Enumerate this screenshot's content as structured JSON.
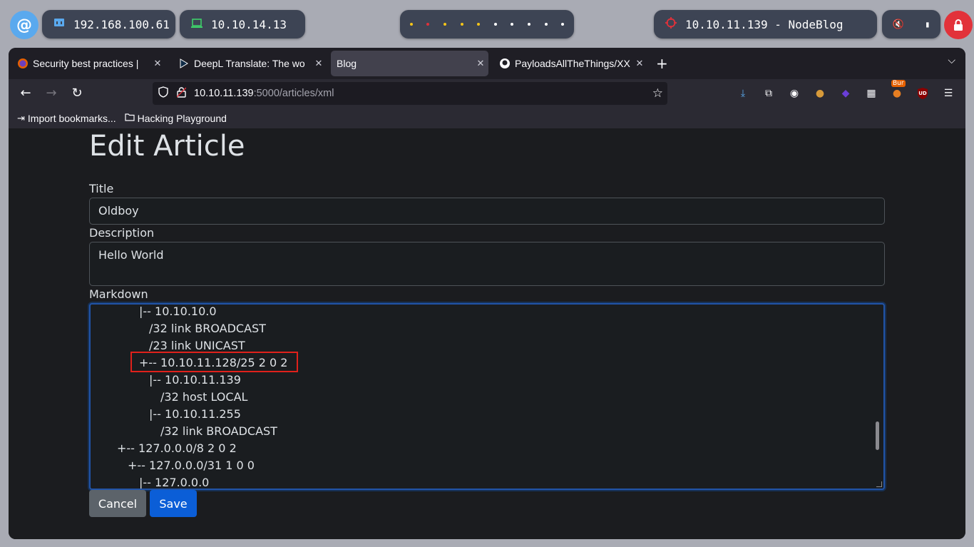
{
  "system_bar": {
    "ip_local": "192.168.100.61",
    "ip_vpn": "10.10.14.13",
    "target": "10.10.11.139 - NodeBlog",
    "workspace_colors": [
      "#f5c518",
      "#e0313a",
      "#f5c518",
      "#f5c518",
      "#f5c518",
      "#ffffff",
      "#ffffff",
      "#ffffff",
      "#ffffff",
      "#ffffff"
    ]
  },
  "browser": {
    "tabs": [
      {
        "label": "Security best practices |",
        "icon": "firefox-icon"
      },
      {
        "label": "DeepL Translate: The wo",
        "icon": "deepl-icon"
      },
      {
        "label": "Blog",
        "icon": "none",
        "active": true
      },
      {
        "label": "PayloadsAllTheThings/XX",
        "icon": "github-icon"
      }
    ],
    "url": {
      "host": "10.10.11.139",
      "path": ":5000/articles/xml"
    },
    "bookmarks": [
      {
        "label": "Import bookmarks...",
        "icon": "import-icon"
      },
      {
        "label": "Hacking Playground",
        "icon": "folder-icon"
      }
    ],
    "extensions": [
      "download-icon",
      "extensions-icon",
      "spy-icon",
      "cookie-icon",
      "wappalyzer-icon",
      "chart-icon",
      "burp-icon",
      "ublock-icon",
      "menu-icon"
    ],
    "burp_badge": "Bur",
    "ublock_label": "UD"
  },
  "page": {
    "title": "Edit Article",
    "fields": {
      "title_label": "Title",
      "title_value": "Oldboy",
      "desc_label": "Description",
      "desc_value": "Hello World",
      "markdown_label": "Markdown"
    },
    "markdown_lines": [
      "|-- 10.10.10.0",
      "/32 link BROADCAST",
      "/23 link UNICAST",
      "+-- 10.10.11.128/25 2 0 2",
      "|-- 10.10.11.139",
      "/32 host LOCAL",
      "|-- 10.10.11.255",
      "/32 link BROADCAST",
      "+-- 127.0.0.0/8 2 0 2",
      "+-- 127.0.0.0/31 1 0 0",
      "|-- 127.0.0.0"
    ],
    "buttons": {
      "cancel": "Cancel",
      "save": "Save"
    }
  },
  "colors": {
    "accent": "#0b5ed7",
    "highlight": "#e0211b",
    "lock": "#e2323a"
  }
}
